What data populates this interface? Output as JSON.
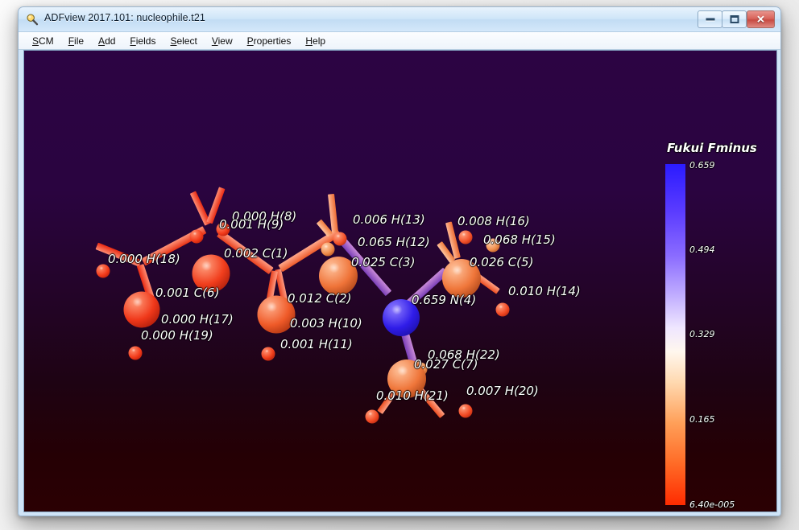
{
  "window": {
    "title": "ADFview 2017.101: nucleophile.t21",
    "icon": "magnifier-icon",
    "minimize_label": "",
    "maximize_label": "",
    "close_label": "✕"
  },
  "menubar": {
    "items": [
      {
        "label": "SCM",
        "mnemonic": "S"
      },
      {
        "label": "File",
        "mnemonic": "F"
      },
      {
        "label": "Add",
        "mnemonic": "A"
      },
      {
        "label": "Fields",
        "mnemonic": "F"
      },
      {
        "label": "Select",
        "mnemonic": "S"
      },
      {
        "label": "View",
        "mnemonic": "V"
      },
      {
        "label": "Properties",
        "mnemonic": "P"
      },
      {
        "label": "Help",
        "mnemonic": "H"
      }
    ]
  },
  "viewport": {
    "background_top": "#2c0443",
    "background_bottom": "#2b0003"
  },
  "colorbar": {
    "title": "Fukui Fminus",
    "ticks": [
      "0.659",
      "0.494",
      "0.329",
      "0.165",
      "6.40e-005"
    ],
    "max_color": "#2b1bff",
    "mid_color": "#fff7ee",
    "min_color": "#ff2b00"
  },
  "chart_data": {
    "type": "scatter",
    "title": "Fukui Fminus",
    "description": "3D ball-and-stick molecular structure with per-atom Fukui f- values",
    "colorbar_range": [
      6.4e-05,
      0.659
    ],
    "colorbar_ticks": [
      0.659,
      0.494,
      0.329,
      0.165,
      6.4e-05
    ],
    "atoms": [
      {
        "label": "0.002 C(1)",
        "element": "C",
        "index": 1,
        "value": 0.002
      },
      {
        "label": "0.012 C(2)",
        "element": "C",
        "index": 2,
        "value": 0.012
      },
      {
        "label": "0.025 C(3)",
        "element": "C",
        "index": 3,
        "value": 0.025
      },
      {
        "label": "0.659 N(4)",
        "element": "N",
        "index": 4,
        "value": 0.659
      },
      {
        "label": "0.026 C(5)",
        "element": "C",
        "index": 5,
        "value": 0.026
      },
      {
        "label": "0.001 C(6)",
        "element": "C",
        "index": 6,
        "value": 0.001
      },
      {
        "label": "0.027 C(7)",
        "element": "C",
        "index": 7,
        "value": 0.027
      },
      {
        "label": "0.000 H(8)",
        "element": "H",
        "index": 8,
        "value": 0.0
      },
      {
        "label": "0.001 H(9)",
        "element": "H",
        "index": 9,
        "value": 0.001
      },
      {
        "label": "0.003 H(10)",
        "element": "H",
        "index": 10,
        "value": 0.003
      },
      {
        "label": "0.001 H(11)",
        "element": "H",
        "index": 11,
        "value": 0.001
      },
      {
        "label": "0.065 H(12)",
        "element": "H",
        "index": 12,
        "value": 0.065
      },
      {
        "label": "0.006 H(13)",
        "element": "H",
        "index": 13,
        "value": 0.006
      },
      {
        "label": "0.010 H(14)",
        "element": "H",
        "index": 14,
        "value": 0.01
      },
      {
        "label": "0.068 H(15)",
        "element": "H",
        "index": 15,
        "value": 0.068
      },
      {
        "label": "0.008 H(16)",
        "element": "H",
        "index": 16,
        "value": 0.008
      },
      {
        "label": "0.000 H(17)",
        "element": "H",
        "index": 17,
        "value": 0.0
      },
      {
        "label": "0.000 H(18)",
        "element": "H",
        "index": 18,
        "value": 0.0
      },
      {
        "label": "0.000 H(19)",
        "element": "H",
        "index": 19,
        "value": 0.0
      },
      {
        "label": "0.007 H(20)",
        "element": "H",
        "index": 20,
        "value": 0.007
      },
      {
        "label": "0.010 H(21)",
        "element": "H",
        "index": 21,
        "value": 0.01
      },
      {
        "label": "0.068 H(22)",
        "element": "H",
        "index": 22,
        "value": 0.068
      }
    ]
  },
  "labels": {
    "h18": "0.000 H(18)",
    "c6": "0.001 C(6)",
    "h17": "0.000 H(17)",
    "h19": "0.000 H(19)",
    "h8": "0.000 H(8)",
    "h9": "0.001 H(9)",
    "c1": "0.002 C(1)",
    "c2": "0.012 C(2)",
    "h10": "0.003 H(10)",
    "h11": "0.001 H(11)",
    "h13": "0.006 H(13)",
    "h12": "0.065 H(12)",
    "c3": "0.025 C(3)",
    "h16": "0.008 H(16)",
    "h15": "0.068 H(15)",
    "c5": "0.026 C(5)",
    "n4": "0.659 N(4)",
    "h14": "0.010 H(14)",
    "h22": "0.068 H(22)",
    "c7": "0.027 C(7)",
    "h21": "0.010 H(21)",
    "h20": "0.007 H(20)"
  }
}
